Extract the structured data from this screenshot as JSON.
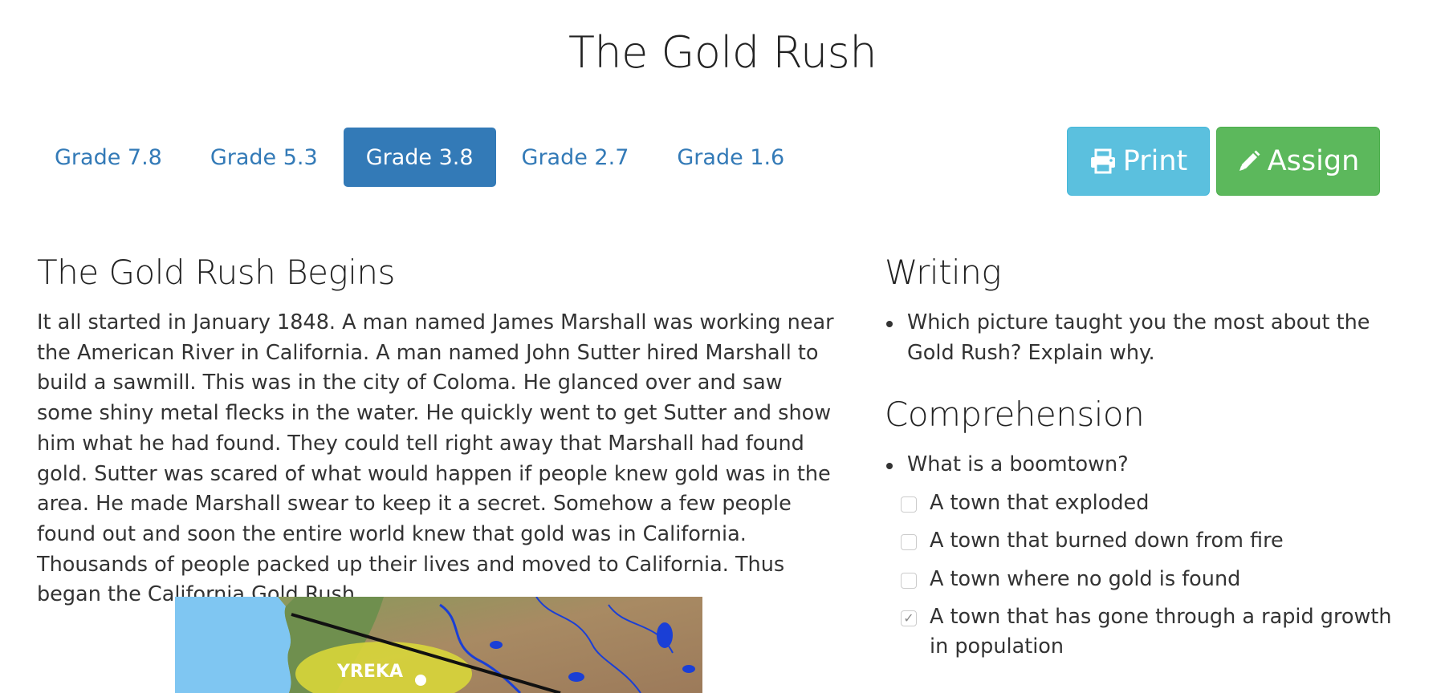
{
  "page": {
    "title": "The Gold Rush"
  },
  "grade_tabs": [
    {
      "label": "Grade 7.8",
      "active": false
    },
    {
      "label": "Grade 5.3",
      "active": false
    },
    {
      "label": "Grade 3.8",
      "active": true
    },
    {
      "label": "Grade 2.7",
      "active": false
    },
    {
      "label": "Grade 1.6",
      "active": false
    }
  ],
  "actions": {
    "print_label": "Print",
    "print_icon": "printer-icon",
    "assign_label": "Assign",
    "assign_icon": "pencil-icon"
  },
  "story": {
    "heading": "The Gold Rush Begins",
    "body": "It all started in January 1848. A man named James Marshall was working near the American River in California. A man named John Sutter hired Marshall to build a sawmill. This was in the city of Coloma. He glanced over and saw some shiny metal flecks in the water. He quickly went to get Sutter and show him what he had found. They could tell right away that Marshall had found gold. Sutter was scared of what would happen if people knew gold was in the area. He made Marshall swear to keep it a secret. Somehow a few people found out and soon the entire world knew that gold was in California. Thousands of people packed up their lives and moved to California. Thus began the California Gold Rush.",
    "map_label": "YREKA"
  },
  "writing": {
    "heading": "Writing",
    "items": [
      "Which picture taught you the most about the Gold Rush? Explain why."
    ]
  },
  "comprehension": {
    "heading": "Comprehension",
    "question": "What is a boomtown?",
    "options": [
      {
        "label": "A town that exploded",
        "checked": false
      },
      {
        "label": "A town that burned down from fire",
        "checked": false
      },
      {
        "label": "A town where no gold is found",
        "checked": false
      },
      {
        "label": "A town that has gone through a rapid growth in population",
        "checked": true
      }
    ]
  },
  "colors": {
    "primary": "#337ab7",
    "info": "#5bc0de",
    "success": "#5cb85c"
  }
}
